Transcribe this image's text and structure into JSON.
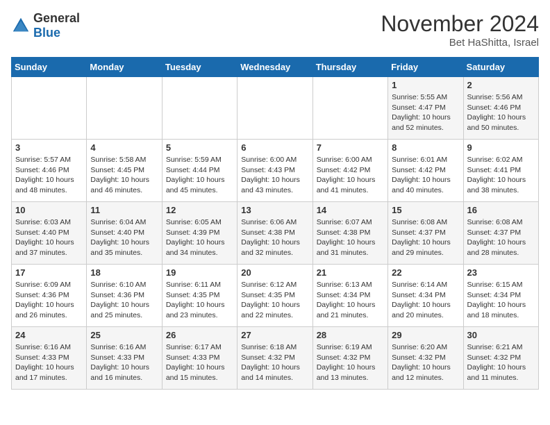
{
  "header": {
    "logo_general": "General",
    "logo_blue": "Blue",
    "month": "November 2024",
    "location": "Bet HaShitta, Israel"
  },
  "weekdays": [
    "Sunday",
    "Monday",
    "Tuesday",
    "Wednesday",
    "Thursday",
    "Friday",
    "Saturday"
  ],
  "weeks": [
    [
      {
        "day": "",
        "info": ""
      },
      {
        "day": "",
        "info": ""
      },
      {
        "day": "",
        "info": ""
      },
      {
        "day": "",
        "info": ""
      },
      {
        "day": "",
        "info": ""
      },
      {
        "day": "1",
        "info": "Sunrise: 5:55 AM\nSunset: 4:47 PM\nDaylight: 10 hours\nand 52 minutes."
      },
      {
        "day": "2",
        "info": "Sunrise: 5:56 AM\nSunset: 4:46 PM\nDaylight: 10 hours\nand 50 minutes."
      }
    ],
    [
      {
        "day": "3",
        "info": "Sunrise: 5:57 AM\nSunset: 4:46 PM\nDaylight: 10 hours\nand 48 minutes."
      },
      {
        "day": "4",
        "info": "Sunrise: 5:58 AM\nSunset: 4:45 PM\nDaylight: 10 hours\nand 46 minutes."
      },
      {
        "day": "5",
        "info": "Sunrise: 5:59 AM\nSunset: 4:44 PM\nDaylight: 10 hours\nand 45 minutes."
      },
      {
        "day": "6",
        "info": "Sunrise: 6:00 AM\nSunset: 4:43 PM\nDaylight: 10 hours\nand 43 minutes."
      },
      {
        "day": "7",
        "info": "Sunrise: 6:00 AM\nSunset: 4:42 PM\nDaylight: 10 hours\nand 41 minutes."
      },
      {
        "day": "8",
        "info": "Sunrise: 6:01 AM\nSunset: 4:42 PM\nDaylight: 10 hours\nand 40 minutes."
      },
      {
        "day": "9",
        "info": "Sunrise: 6:02 AM\nSunset: 4:41 PM\nDaylight: 10 hours\nand 38 minutes."
      }
    ],
    [
      {
        "day": "10",
        "info": "Sunrise: 6:03 AM\nSunset: 4:40 PM\nDaylight: 10 hours\nand 37 minutes."
      },
      {
        "day": "11",
        "info": "Sunrise: 6:04 AM\nSunset: 4:40 PM\nDaylight: 10 hours\nand 35 minutes."
      },
      {
        "day": "12",
        "info": "Sunrise: 6:05 AM\nSunset: 4:39 PM\nDaylight: 10 hours\nand 34 minutes."
      },
      {
        "day": "13",
        "info": "Sunrise: 6:06 AM\nSunset: 4:38 PM\nDaylight: 10 hours\nand 32 minutes."
      },
      {
        "day": "14",
        "info": "Sunrise: 6:07 AM\nSunset: 4:38 PM\nDaylight: 10 hours\nand 31 minutes."
      },
      {
        "day": "15",
        "info": "Sunrise: 6:08 AM\nSunset: 4:37 PM\nDaylight: 10 hours\nand 29 minutes."
      },
      {
        "day": "16",
        "info": "Sunrise: 6:08 AM\nSunset: 4:37 PM\nDaylight: 10 hours\nand 28 minutes."
      }
    ],
    [
      {
        "day": "17",
        "info": "Sunrise: 6:09 AM\nSunset: 4:36 PM\nDaylight: 10 hours\nand 26 minutes."
      },
      {
        "day": "18",
        "info": "Sunrise: 6:10 AM\nSunset: 4:36 PM\nDaylight: 10 hours\nand 25 minutes."
      },
      {
        "day": "19",
        "info": "Sunrise: 6:11 AM\nSunset: 4:35 PM\nDaylight: 10 hours\nand 23 minutes."
      },
      {
        "day": "20",
        "info": "Sunrise: 6:12 AM\nSunset: 4:35 PM\nDaylight: 10 hours\nand 22 minutes."
      },
      {
        "day": "21",
        "info": "Sunrise: 6:13 AM\nSunset: 4:34 PM\nDaylight: 10 hours\nand 21 minutes."
      },
      {
        "day": "22",
        "info": "Sunrise: 6:14 AM\nSunset: 4:34 PM\nDaylight: 10 hours\nand 20 minutes."
      },
      {
        "day": "23",
        "info": "Sunrise: 6:15 AM\nSunset: 4:34 PM\nDaylight: 10 hours\nand 18 minutes."
      }
    ],
    [
      {
        "day": "24",
        "info": "Sunrise: 6:16 AM\nSunset: 4:33 PM\nDaylight: 10 hours\nand 17 minutes."
      },
      {
        "day": "25",
        "info": "Sunrise: 6:16 AM\nSunset: 4:33 PM\nDaylight: 10 hours\nand 16 minutes."
      },
      {
        "day": "26",
        "info": "Sunrise: 6:17 AM\nSunset: 4:33 PM\nDaylight: 10 hours\nand 15 minutes."
      },
      {
        "day": "27",
        "info": "Sunrise: 6:18 AM\nSunset: 4:32 PM\nDaylight: 10 hours\nand 14 minutes."
      },
      {
        "day": "28",
        "info": "Sunrise: 6:19 AM\nSunset: 4:32 PM\nDaylight: 10 hours\nand 13 minutes."
      },
      {
        "day": "29",
        "info": "Sunrise: 6:20 AM\nSunset: 4:32 PM\nDaylight: 10 hours\nand 12 minutes."
      },
      {
        "day": "30",
        "info": "Sunrise: 6:21 AM\nSunset: 4:32 PM\nDaylight: 10 hours\nand 11 minutes."
      }
    ]
  ]
}
